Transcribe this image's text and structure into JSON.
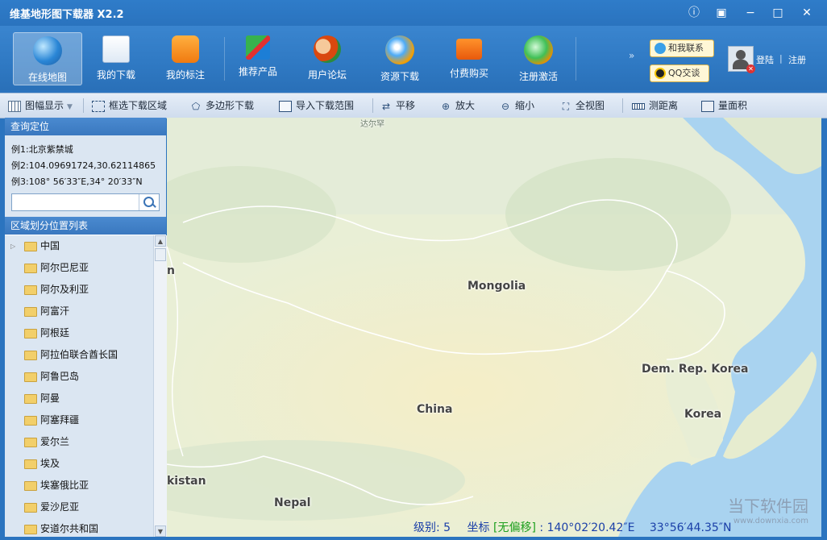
{
  "window": {
    "title": "维基地形图下载器 X2.2"
  },
  "main_toolbar": {
    "buttons": [
      {
        "label": "在线地图"
      },
      {
        "label": "我的下载"
      },
      {
        "label": "我的标注"
      },
      {
        "label": "推荐产品"
      },
      {
        "label": "用户论坛"
      },
      {
        "label": "资源下载"
      },
      {
        "label": "付费购买"
      },
      {
        "label": "注册激活"
      }
    ],
    "contact_label": "和我联系",
    "qq_label": "QQ交谈",
    "login_label": "登陆",
    "register_label": "注册"
  },
  "sub_toolbar": {
    "items": [
      {
        "label": "图幅显示"
      },
      {
        "label": "框选下载区域"
      },
      {
        "label": "多边形下载"
      },
      {
        "label": "导入下载范围"
      },
      {
        "label": "平移"
      },
      {
        "label": "放大"
      },
      {
        "label": "缩小"
      },
      {
        "label": "全视图"
      },
      {
        "label": "测距离"
      },
      {
        "label": "量面积"
      }
    ]
  },
  "query_panel": {
    "title": "查询定位",
    "example1": "例1:北京紫禁城",
    "example2": "例2:104.09691724,30.62114865",
    "example3": "例3:108° 56′33″E,34° 20′33″N",
    "search_value": ""
  },
  "region_panel": {
    "title": "区域划分位置列表",
    "items": [
      "中国",
      "阿尔巴尼亚",
      "阿尔及利亚",
      "阿富汗",
      "阿根廷",
      "阿拉伯联合酋长国",
      "阿鲁巴岛",
      "阿曼",
      "阿塞拜疆",
      "爱尔兰",
      "埃及",
      "埃塞俄比亚",
      "爱沙尼亚",
      "安道尔共和国"
    ]
  },
  "map": {
    "labels": [
      "Mongolia",
      "China",
      "Dem. Rep. Korea",
      "Korea",
      "Nepal",
      "n",
      "kistan"
    ],
    "road_label": "达尔罕"
  },
  "status_bar": {
    "level_label": "级别:",
    "level_value": "5",
    "coord_label": "坐标",
    "no_offset": "[无偏移]",
    "colon": ":",
    "longitude": "140°02′20.42″E",
    "latitude": "33°56′44.35″N"
  },
  "watermark": {
    "text": "当下软件园",
    "url": "www.downxia.com"
  },
  "colors": {
    "titlebar": "#2f7cc9",
    "sea": "#a9d3f0",
    "land": "#eef0dc",
    "status_text": "#1a3fa8",
    "no_offset": "#1ea01e"
  }
}
